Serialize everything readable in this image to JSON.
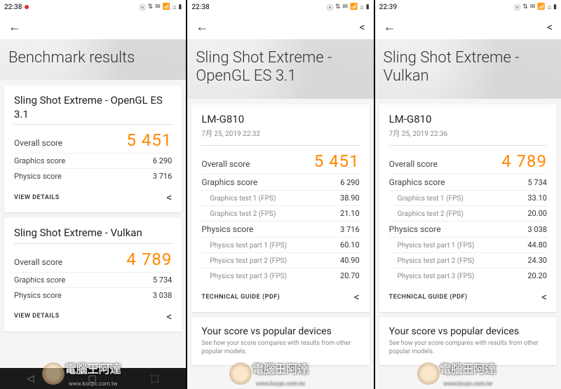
{
  "panels": [
    {
      "status_time": "22:38",
      "has_red_dot": true,
      "hero_title": "Benchmark results",
      "device_label": "",
      "timestamp": "",
      "is_summary": true,
      "cards": [
        {
          "title": "Sling Shot Extreme - OpenGL ES 3.1",
          "overall_label": "Overall score",
          "overall_value": "5 451",
          "rows": [
            {
              "label": "Graphics score",
              "value": "6 290",
              "sub": false
            },
            {
              "label": "Physics score",
              "value": "3 716",
              "sub": false
            }
          ],
          "footer_link": "VIEW DETAILS"
        },
        {
          "title": "Sling Shot Extreme - Vulkan",
          "overall_label": "Overall score",
          "overall_value": "4 789",
          "rows": [
            {
              "label": "Graphics score",
              "value": "5 734",
              "sub": false
            },
            {
              "label": "Physics score",
              "value": "3 038",
              "sub": false
            }
          ],
          "footer_link": "VIEW DETAILS"
        }
      ],
      "compare": null
    },
    {
      "status_time": "22:38",
      "has_red_dot": false,
      "hero_title": "Sling Shot Extreme - OpenGL ES 3.1",
      "is_summary": false,
      "detail": {
        "device": "LM-G810",
        "timestamp": "7月 25, 2019 22:32",
        "overall_label": "Overall score",
        "overall_value": "5 451",
        "rows": [
          {
            "label": "Graphics score",
            "value": "6 290",
            "sub": false
          },
          {
            "label": "Graphics test 1 (FPS)",
            "value": "38.90",
            "sub": true
          },
          {
            "label": "Graphics test 2 (FPS)",
            "value": "21.10",
            "sub": true
          },
          {
            "label": "Physics score",
            "value": "3 716",
            "sub": false
          },
          {
            "label": "Physics test part 1 (FPS)",
            "value": "60.10",
            "sub": true
          },
          {
            "label": "Physics test part 2 (FPS)",
            "value": "40.90",
            "sub": true
          },
          {
            "label": "Physics test part 3 (FPS)",
            "value": "20.70",
            "sub": true
          }
        ],
        "footer_link": "TECHNICAL GUIDE (PDF)"
      },
      "compare": {
        "title": "Your score vs popular devices",
        "sub": "See how your score compares with results from other popular models."
      }
    },
    {
      "status_time": "22:39",
      "has_red_dot": false,
      "hero_title": "Sling Shot Extreme - Vulkan",
      "is_summary": false,
      "detail": {
        "device": "LM-G810",
        "timestamp": "7月 25, 2019 22:36",
        "overall_label": "Overall score",
        "overall_value": "4 789",
        "rows": [
          {
            "label": "Graphics score",
            "value": "5 734",
            "sub": false
          },
          {
            "label": "Graphics test 1 (FPS)",
            "value": "33.10",
            "sub": true
          },
          {
            "label": "Graphics test 2 (FPS)",
            "value": "20.00",
            "sub": true
          },
          {
            "label": "Physics score",
            "value": "3 038",
            "sub": false
          },
          {
            "label": "Physics test part 1 (FPS)",
            "value": "44.80",
            "sub": true
          },
          {
            "label": "Physics test part 2 (FPS)",
            "value": "24.30",
            "sub": true
          },
          {
            "label": "Physics test part 3 (FPS)",
            "value": "20.20",
            "sub": true
          }
        ],
        "footer_link": "TECHNICAL GUIDE (PDF)"
      },
      "compare": {
        "title": "Your score vs popular devices",
        "sub": "See how your score compares with results from other popular models."
      }
    }
  ],
  "status_icons": [
    "ⓝ",
    "⇅",
    "✉",
    "📶",
    "⌂",
    "▮"
  ],
  "watermark_text": "電腦王阿達",
  "watermark_url": "www.kocpc.com.tw"
}
